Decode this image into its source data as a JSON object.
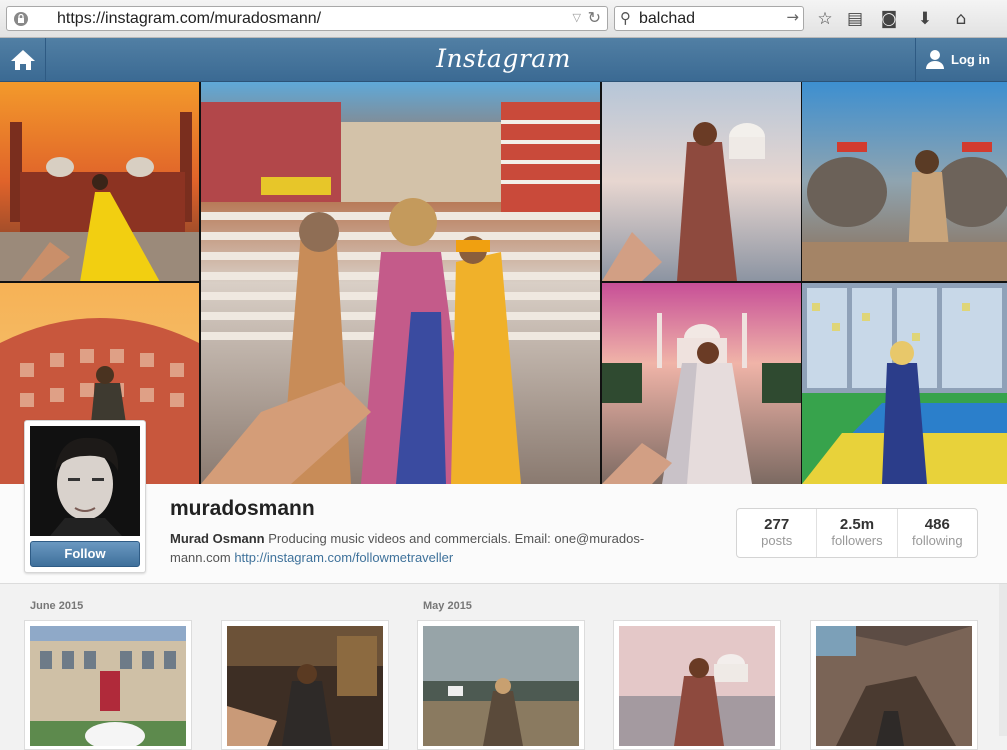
{
  "browser": {
    "url": "https://instagram.com/muradosmann/",
    "search_value": "balchad",
    "icons": [
      "lock-icon",
      "reload-icon",
      "search-icon",
      "star-icon",
      "reading-list-icon",
      "pocket-icon",
      "download-icon",
      "home-icon"
    ]
  },
  "header": {
    "logo": "Instagram",
    "login_label": "Log in"
  },
  "profile": {
    "username": "muradosmann",
    "full_name": "Murad Osmann",
    "bio": "Producing music videos and commercials. Email: one@murados-mann.com",
    "link": "http://instagram.com/followmetraveller",
    "follow_label": "Follow",
    "stats": [
      {
        "value": "277",
        "label": "posts"
      },
      {
        "value": "2.5m",
        "label": "followers"
      },
      {
        "value": "486",
        "label": "following"
      }
    ]
  },
  "feed": {
    "months": [
      "June 2015",
      "May 2015"
    ]
  },
  "colors": {
    "header_blue": "#517fa4",
    "link_blue": "#3f729b",
    "follow_blue": "#4f7fab"
  }
}
